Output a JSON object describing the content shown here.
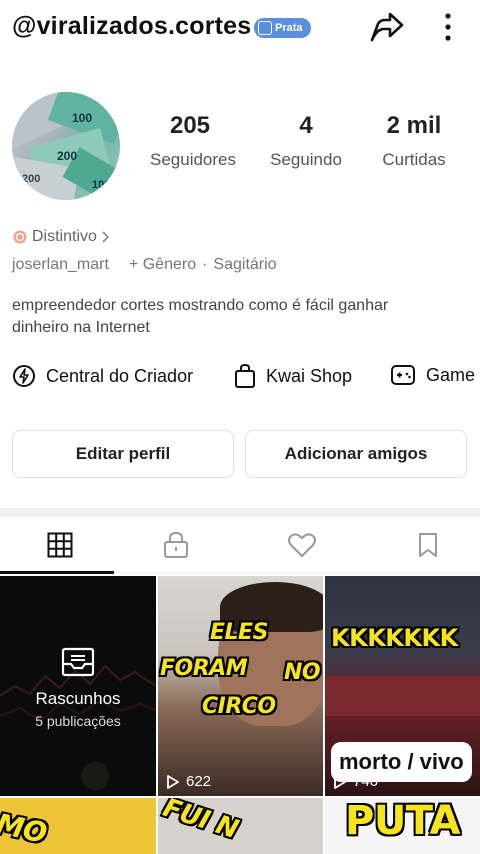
{
  "header": {
    "username": "@viralizados.cortes",
    "badge_label": "Prata",
    "badge_color": "#5b8fdd",
    "share_icon": "share-arrow-icon",
    "more_icon": "more-vertical-icon"
  },
  "profile": {
    "stats": [
      {
        "value": "205",
        "label": "Seguidores"
      },
      {
        "value": "4",
        "label": "Seguindo"
      },
      {
        "value": "2 mil",
        "label": "Curtidas"
      }
    ],
    "distintivo_label": "Distintivo",
    "handle": "joserlan_mart",
    "gender_label": "+ Gênero",
    "separator": "·",
    "sign": "Sagitário",
    "bio_line1": "empreendedor cortes mostrando como é fácil ganhar",
    "bio_line2": "dinheiro na Internet"
  },
  "tools": [
    {
      "label": "Central do Criador",
      "icon": "lightning-icon"
    },
    {
      "label": "Kwai Shop",
      "icon": "shopping-bag-icon"
    },
    {
      "label": "Game",
      "icon": "gamepad-icon"
    }
  ],
  "buttons": {
    "edit_profile": "Editar perfil",
    "add_friends": "Adicionar amigos"
  },
  "tabs": [
    {
      "name": "grid",
      "icon": "grid-icon",
      "active": true
    },
    {
      "name": "private",
      "icon": "lock-icon",
      "active": false
    },
    {
      "name": "liked",
      "icon": "heart-icon",
      "active": false
    },
    {
      "name": "saved",
      "icon": "bookmark-icon",
      "active": false
    }
  ],
  "grid": {
    "drafts_title": "Rascunhos",
    "drafts_count": "5 publicações",
    "video2_caption_1": "ELES",
    "video2_caption_2": "FORAM",
    "video2_caption_3": "NO",
    "video2_caption_4": "CIRCO",
    "video2_views": "622",
    "video3_caption": "KKKKKKK",
    "video3_label": "morto / vivo",
    "video3_views": "746",
    "video4_caption": "MO",
    "video5_caption": "FUI N",
    "video6_caption": "PUTA"
  }
}
